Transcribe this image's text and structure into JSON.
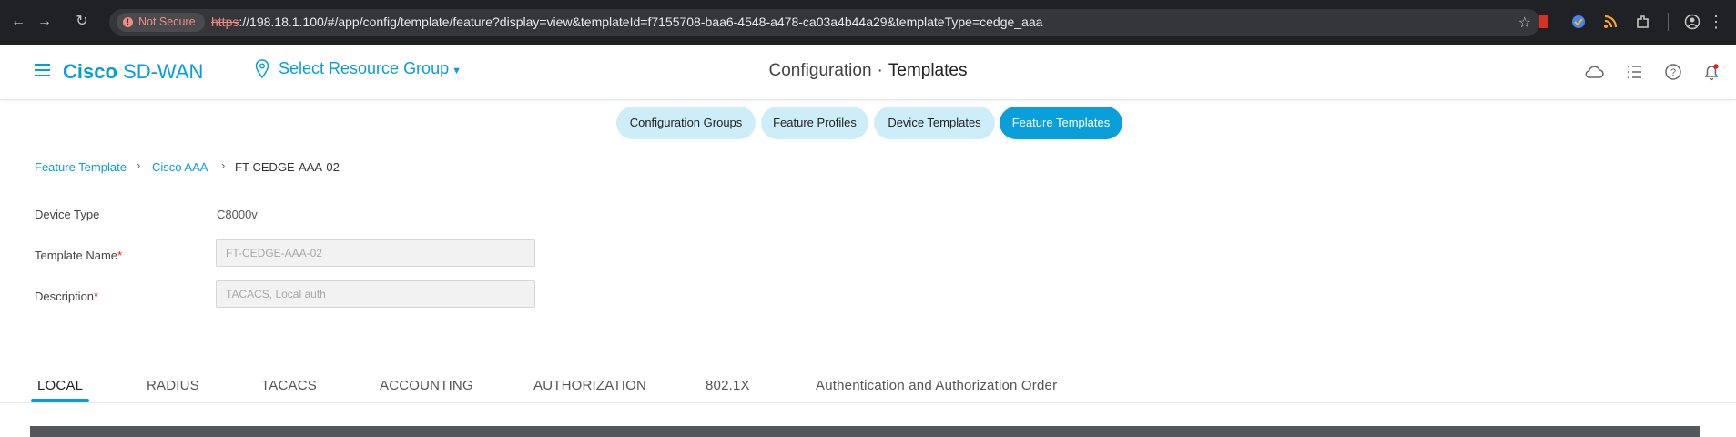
{
  "browser": {
    "not_secure_label": "Not Secure",
    "url_scheme": "https",
    "url_rest": "://198.18.1.100/#/app/config/template/feature?display=view&templateId=f7155708-baa6-4548-a478-ca03a4b44a29&templateType=cedge_aaa"
  },
  "header": {
    "brand_bold": "Cisco",
    "brand_rest": " SD-WAN",
    "resource_group": "Select Resource Group",
    "title_section": "Configuration",
    "title_separator": "·",
    "title_page": "Templates"
  },
  "pills": [
    {
      "label": "Configuration Groups",
      "active": false
    },
    {
      "label": "Feature Profiles",
      "active": false
    },
    {
      "label": "Device Templates",
      "active": false
    },
    {
      "label": "Feature Templates",
      "active": true
    }
  ],
  "breadcrumb": {
    "items": [
      "Feature Template",
      "Cisco AAA",
      "FT-CEDGE-AAA-02"
    ]
  },
  "form": {
    "device_type_label": "Device Type",
    "device_type_value": "C8000v",
    "template_name_label": "Template Name",
    "template_name_value": "FT-CEDGE-AAA-02",
    "description_label": "Description",
    "description_value": "TACACS, Local auth",
    "required_marker": "*"
  },
  "section_tabs": [
    {
      "label": "LOCAL",
      "active": true
    },
    {
      "label": "RADIUS",
      "active": false
    },
    {
      "label": "TACACS",
      "active": false
    },
    {
      "label": "ACCOUNTING",
      "active": false
    },
    {
      "label": "AUTHORIZATION",
      "active": false
    },
    {
      "label": "802.1X",
      "active": false
    },
    {
      "label": "Authentication and Authorization Order",
      "active": false
    }
  ],
  "colors": {
    "accent": "#049fd9",
    "pill_bg": "#cdeef8",
    "pill_active": "#0a9fd8",
    "required": "#e2231a"
  }
}
